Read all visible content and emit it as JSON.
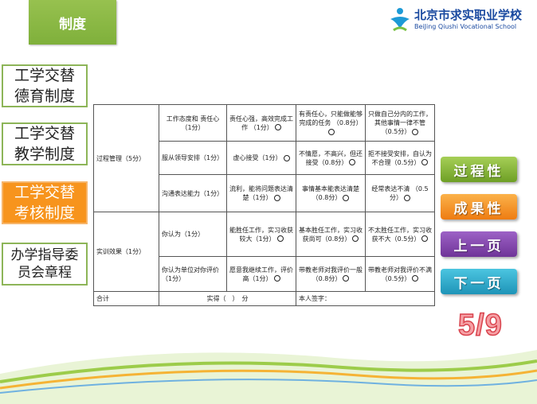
{
  "header": {
    "title": "制度"
  },
  "logo": {
    "cn": "北京市求实职业学校",
    "en": "BeiJing Qiushi Vocational School"
  },
  "nav": [
    {
      "label": "工学交替德育制度"
    },
    {
      "label": "工学交替教学制度"
    },
    {
      "label": "工学交替考核制度"
    },
    {
      "label": "办学指导委员会章程"
    }
  ],
  "table": {
    "process": {
      "label": "过程管理（5分）",
      "rows": [
        {
          "item": "工作态度和 责任心（1分）",
          "c1": "责任心强，高效完成工作 （1分）",
          "c2": "有责任心，只能做能够完成的任务 （0.8分）",
          "c3": "只做自己分内的工作，其他事情一律不管（0.5分）"
        },
        {
          "item": "服从领导安排（1分）",
          "c1": "虚心接受（1分）",
          "c2": "不情愿，不高兴，但还接受（0.8分）",
          "c3": "拒不接受安排，自认为不合理（0.5分）"
        },
        {
          "item": "沟通表达能力（1分）",
          "c1": "流利，能将问题表达清楚（1分）",
          "c2": "事情基本能表达清楚 （0.8分）",
          "c3": "经常表达不清 （0.5分）"
        }
      ]
    },
    "result": {
      "label": "实训效果（1分）",
      "rows": [
        {
          "item": "你认为（1分）",
          "c1": "能胜任工作，实习收获较大（1分）",
          "c2": "基本胜任工作，实习收获尚可（0.8分）",
          "c3": "不太胜任工作，实习收获不大（0.5分）"
        },
        {
          "item": "你认为单位对你评价（1分）",
          "c1": "愿意我继续工作，评价高（1分）",
          "c2": "带教老师对我评价一般（0.8分）",
          "c3": "带教老师对我评价不满（0.5分）"
        }
      ]
    },
    "total": {
      "label": "合计",
      "score": "实得（　）　分",
      "sign": "本人签字："
    }
  },
  "side": {
    "process_btn": "过程性",
    "result_btn": "成果性",
    "prev_btn": "上一页",
    "next_btn": "下一页"
  },
  "page": "5/9"
}
